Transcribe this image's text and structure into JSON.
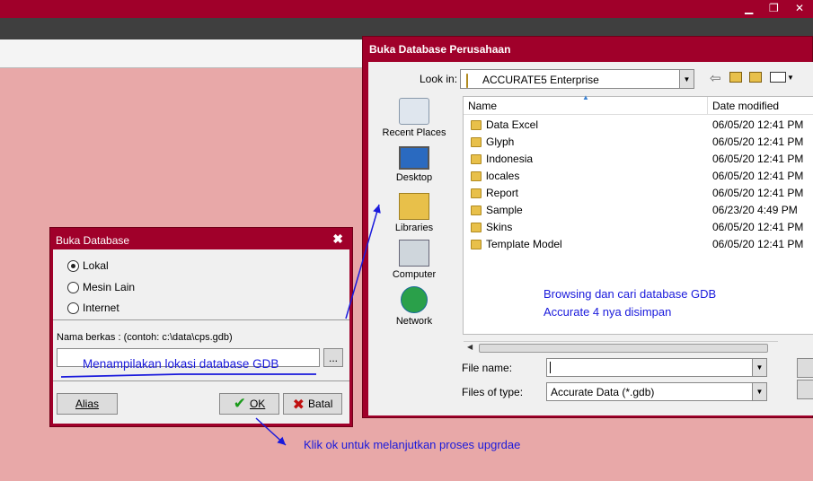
{
  "app": {
    "window_controls": [
      "▁",
      "❐",
      "✕"
    ]
  },
  "buka_database": {
    "title": "Buka Database",
    "close": "✖",
    "options": [
      {
        "label": "Lokal",
        "selected": true
      },
      {
        "label": "Mesin Lain",
        "selected": false
      },
      {
        "label": "Internet",
        "selected": false
      }
    ],
    "path_label": "Nama berkas :  (contoh: c:\\data\\cps.gdb)",
    "path_value": "",
    "browse_label": "...",
    "alias_label": "Alias",
    "ok_label": "OK",
    "cancel_label": "Batal"
  },
  "file_dialog": {
    "title": "Buka Database Perusahaan",
    "look_in_label": "Look in:",
    "look_in_value": "ACCURATE5 Enterprise",
    "places": [
      "Recent Places",
      "Desktop",
      "Libraries",
      "Computer",
      "Network"
    ],
    "columns": {
      "name": "Name",
      "date": "Date modified"
    },
    "files": [
      {
        "name": "Data Excel",
        "date": "06/05/20 12:41 PM"
      },
      {
        "name": "Glyph",
        "date": "06/05/20 12:41 PM"
      },
      {
        "name": "Indonesia",
        "date": "06/05/20 12:41 PM"
      },
      {
        "name": "locales",
        "date": "06/05/20 12:41 PM"
      },
      {
        "name": "Report",
        "date": "06/05/20 12:41 PM"
      },
      {
        "name": "Sample",
        "date": "06/23/20 4:49 PM"
      },
      {
        "name": "Skins",
        "date": "06/05/20 12:41 PM"
      },
      {
        "name": "Template Model",
        "date": "06/05/20 12:41 PM"
      }
    ],
    "filename_label": "File name:",
    "filename_value": "",
    "filetype_label": "Files of type:",
    "filetype_value": "Accurate Data (*.gdb)"
  },
  "annotations": {
    "browse_note_line1": "Browsing dan cari database GDB",
    "browse_note_line2": "Accurate 4 nya disimpan",
    "path_note": "Menampilakan lokasi database GDB",
    "ok_note": "Klik ok untuk melanjutkan proses upgrdae"
  },
  "colors": {
    "accent": "#a0002a",
    "background": "#e8a8a8",
    "annotation": "#1a1adc"
  }
}
